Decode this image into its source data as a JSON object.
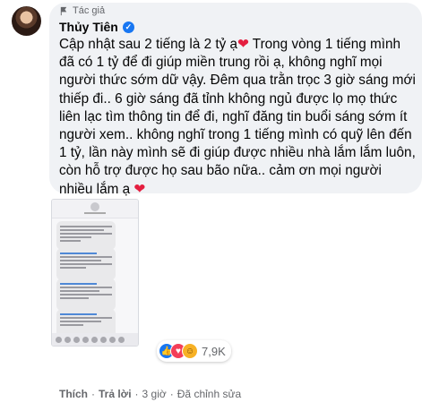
{
  "comment": {
    "author_tag": "Tác giả",
    "author_name": "Thủy Tiên",
    "text_before_heart_1": "Cập nhật sau 2 tiếng là 2 tỷ ạ",
    "text_middle": " Trong vòng 1 tiếng mình đã có 1 tỷ để đi giúp miền trung rồi ạ, không nghĩ mọi người thức sớm dữ vậy. Đêm qua trằn trọc 3 giờ sáng mới thiếp đi.. 6 giờ sáng đã tỉnh không ngủ được lọ mọ thức liên lạc tìm thông tin để đi, nghĩ đăng tin buổi sáng sớm ít người xem.. không nghĩ trong 1 tiếng mình có quỹ lên đến 1 tỷ, lần này mình sẽ đi giúp được nhiều nhà lắm lắm luôn, còn hỗ trợ được họ sau bão nữa.. cảm ơn mọi người nhiều lắm ạ ",
    "heart": "❤"
  },
  "reactions": {
    "count": "7,9K",
    "icons": [
      "like-icon",
      "love-icon",
      "care-icon"
    ]
  },
  "actions": {
    "like": "Thích",
    "reply": "Trả lời",
    "time": "3 giờ",
    "edited": "Đã chỉnh sửa"
  },
  "colors": {
    "bubble": "#f0f2f5",
    "secondary_text": "#65676b",
    "verified": "#1877f2",
    "heart": "#e41e3f"
  }
}
